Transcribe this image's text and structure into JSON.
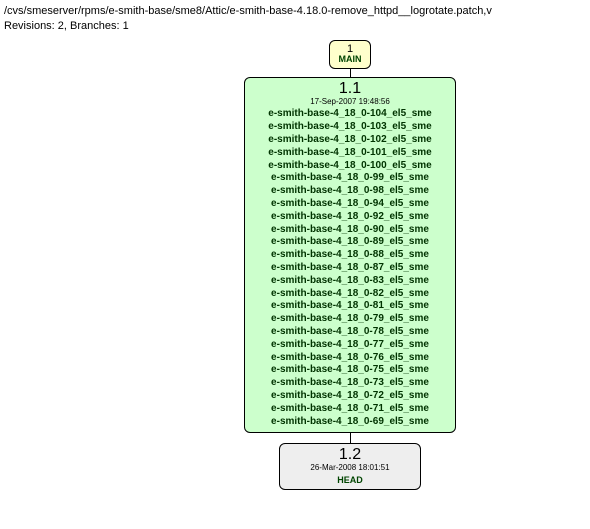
{
  "header": {
    "path": "/cvs/smeserver/rpms/e-smith-base/sme8/Attic/e-smith-base-4.18.0-remove_httpd__logrotate.patch,v",
    "stats": "Revisions: 2, Branches: 1"
  },
  "branch": {
    "number": "1",
    "name": "MAIN"
  },
  "rev1": {
    "number": "1.1",
    "date": "17-Sep-2007 19:48:56",
    "tags": [
      "e-smith-base-4_18_0-104_el5_sme",
      "e-smith-base-4_18_0-103_el5_sme",
      "e-smith-base-4_18_0-102_el5_sme",
      "e-smith-base-4_18_0-101_el5_sme",
      "e-smith-base-4_18_0-100_el5_sme",
      "e-smith-base-4_18_0-99_el5_sme",
      "e-smith-base-4_18_0-98_el5_sme",
      "e-smith-base-4_18_0-94_el5_sme",
      "e-smith-base-4_18_0-92_el5_sme",
      "e-smith-base-4_18_0-90_el5_sme",
      "e-smith-base-4_18_0-89_el5_sme",
      "e-smith-base-4_18_0-88_el5_sme",
      "e-smith-base-4_18_0-87_el5_sme",
      "e-smith-base-4_18_0-83_el5_sme",
      "e-smith-base-4_18_0-82_el5_sme",
      "e-smith-base-4_18_0-81_el5_sme",
      "e-smith-base-4_18_0-79_el5_sme",
      "e-smith-base-4_18_0-78_el5_sme",
      "e-smith-base-4_18_0-77_el5_sme",
      "e-smith-base-4_18_0-76_el5_sme",
      "e-smith-base-4_18_0-75_el5_sme",
      "e-smith-base-4_18_0-73_el5_sme",
      "e-smith-base-4_18_0-72_el5_sme",
      "e-smith-base-4_18_0-71_el5_sme",
      "e-smith-base-4_18_0-69_el5_sme"
    ]
  },
  "rev2": {
    "number": "1.2",
    "date": "26-Mar-2008 18:01:51",
    "head": "HEAD"
  }
}
